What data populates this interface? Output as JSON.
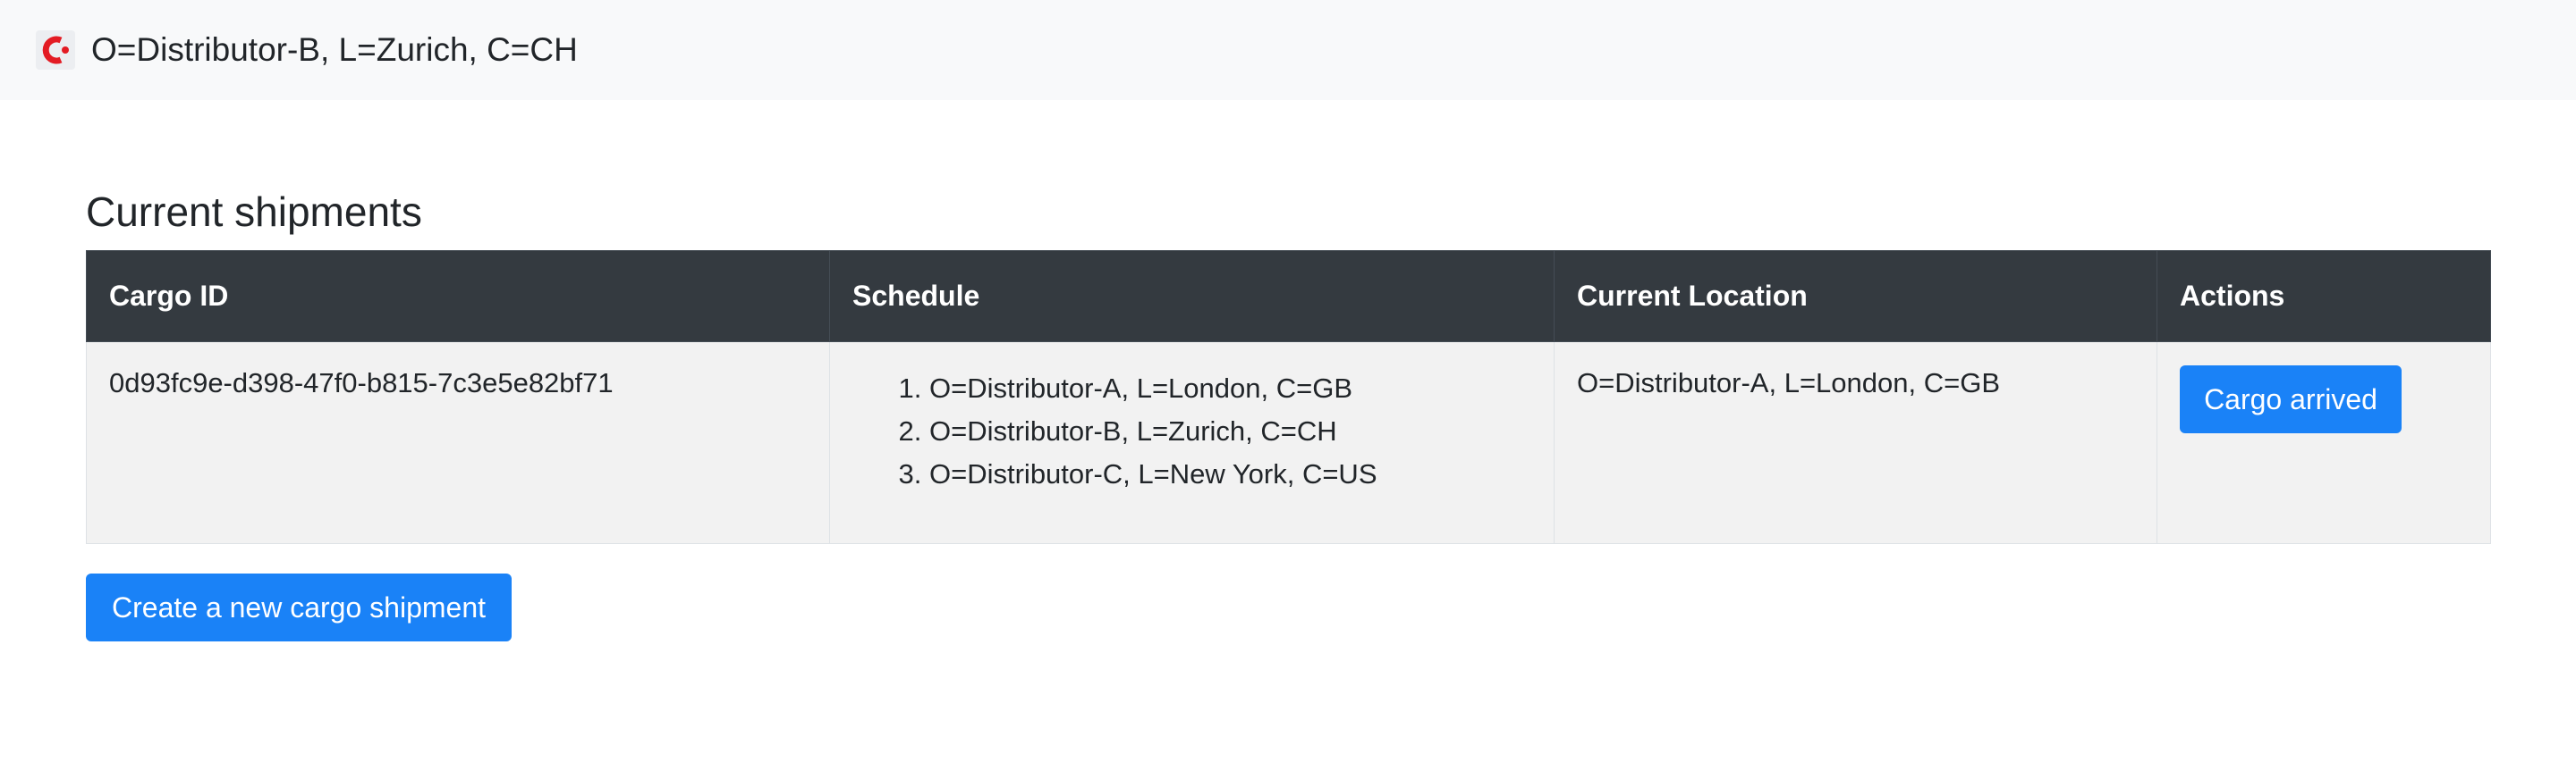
{
  "navbar": {
    "logo_icon": "corda-logo-icon",
    "logo_color": "#e31b23",
    "identity": "O=Distributor-B, L=Zurich, C=CH"
  },
  "main": {
    "title": "Current shipments",
    "table": {
      "headers": [
        "Cargo ID",
        "Schedule",
        "Current Location",
        "Actions"
      ],
      "rows": [
        {
          "cargo_id": "0d93fc9e-d398-47f0-b815-7c3e5e82bf71",
          "schedule": [
            "O=Distributor-A, L=London, C=GB",
            "O=Distributor-B, L=Zurich, C=CH",
            "O=Distributor-C, L=New York, C=US"
          ],
          "current_location": "O=Distributor-A, L=London, C=GB",
          "action_label": "Cargo arrived"
        }
      ]
    },
    "create_button": "Create a new cargo shipment"
  },
  "colors": {
    "header_bg": "#343a40",
    "primary": "#1a82f7",
    "navbar_bg": "#f8f9fa",
    "row_bg": "#f2f2f2"
  }
}
